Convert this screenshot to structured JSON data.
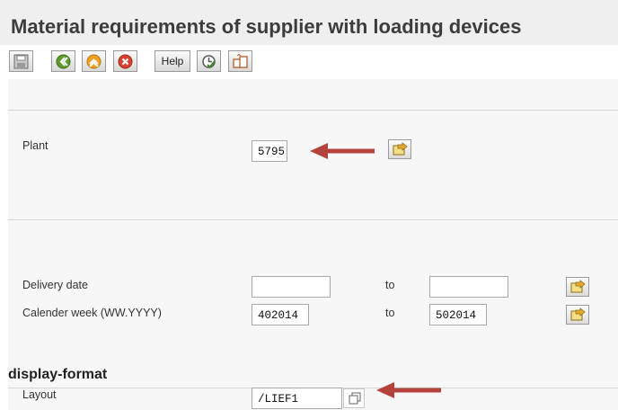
{
  "window": {
    "title": "Material requirements of supplier with loading devices"
  },
  "toolbar": {
    "buttons": [
      {
        "icon": "save-icon"
      },
      {
        "icon": "back-icon"
      },
      {
        "icon": "exit-icon"
      },
      {
        "icon": "cancel-icon"
      },
      {
        "label": "Help"
      },
      {
        "icon": "execute-icon"
      },
      {
        "icon": "get-variant-icon"
      }
    ]
  },
  "form": {
    "plant": {
      "label": "Plant",
      "value": "5795"
    },
    "delivery_date": {
      "label": "Delivery date",
      "from": "",
      "to_label": "to",
      "to": ""
    },
    "calendar_week": {
      "label": "Calender week (WW.YYYY)",
      "from": "402014",
      "to_label": "to",
      "to": "502014"
    },
    "display_format": {
      "heading": "display-format",
      "layout_label": "Layout",
      "layout_value": "/LIEF1"
    }
  },
  "annotations": {
    "arrow_color": "#b5433b"
  }
}
